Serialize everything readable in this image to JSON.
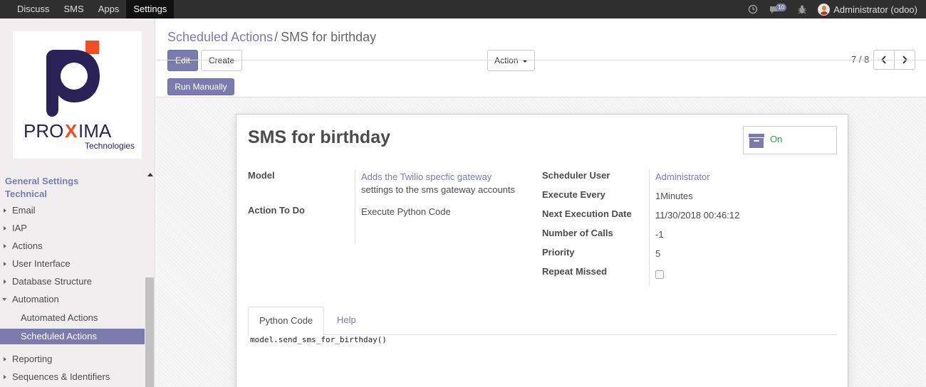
{
  "topbar": {
    "menu": [
      {
        "label": "Discuss"
      },
      {
        "label": "SMS"
      },
      {
        "label": "Apps"
      },
      {
        "label": "Settings"
      }
    ],
    "message_count": "10",
    "user_name": "Administrator (odoo)"
  },
  "sidebar": {
    "logo": {
      "brand_prefix": "PRO",
      "brand_x": "X",
      "brand_suffix": "IMA",
      "sub": "Technologies"
    },
    "headers": [
      "General Settings",
      "Technical"
    ],
    "items": [
      {
        "label": "Email"
      },
      {
        "label": "IAP"
      },
      {
        "label": "Actions"
      },
      {
        "label": "User Interface"
      },
      {
        "label": "Database Structure"
      },
      {
        "label": "Automation"
      },
      {
        "label": "Automated Actions"
      },
      {
        "label": "Scheduled Actions"
      },
      {
        "label": "Reporting"
      },
      {
        "label": "Sequences & Identifiers"
      }
    ]
  },
  "control_panel": {
    "breadcrumb_parent": "Scheduled Actions",
    "breadcrumb_sep": "/",
    "breadcrumb_current": "SMS for birthday",
    "edit_label": "Edit",
    "create_label": "Create",
    "action_label": "Action",
    "pager": "7 / 8",
    "run_manually_label": "Run Manually"
  },
  "form": {
    "title": "SMS for birthday",
    "active_label": "On",
    "model_label": "Model",
    "model_value_line1": "Adds the Twilio specfic gateway",
    "model_value_line2": "settings to the sms gateway accounts",
    "action_label": "Action To Do",
    "action_value": "Execute Python Code",
    "scheduler_user_label": "Scheduler User",
    "scheduler_user_value": "Administrator",
    "execute_every_label": "Execute Every",
    "execute_every_value": "1Minutes",
    "next_exec_label": "Next Execution Date",
    "next_exec_value": "11/30/2018 00:46:12",
    "num_calls_label": "Number of Calls",
    "num_calls_value": "-1",
    "priority_label": "Priority",
    "priority_value": "5",
    "repeat_missed_label": "Repeat Missed",
    "repeat_missed_checked": false,
    "tabs": [
      {
        "label": "Python Code"
      },
      {
        "label": "Help"
      }
    ],
    "code": "model.send_sms_for_birthday()"
  },
  "colors": {
    "accent": "#7c7bad",
    "topbar": "#2f2f2f",
    "on_green": "#28a745"
  },
  "icons": [
    "clock-icon",
    "chat-icon",
    "bug-icon",
    "archive-icon",
    "chevron-left-icon",
    "chevron-right-icon",
    "caret-down-icon"
  ]
}
